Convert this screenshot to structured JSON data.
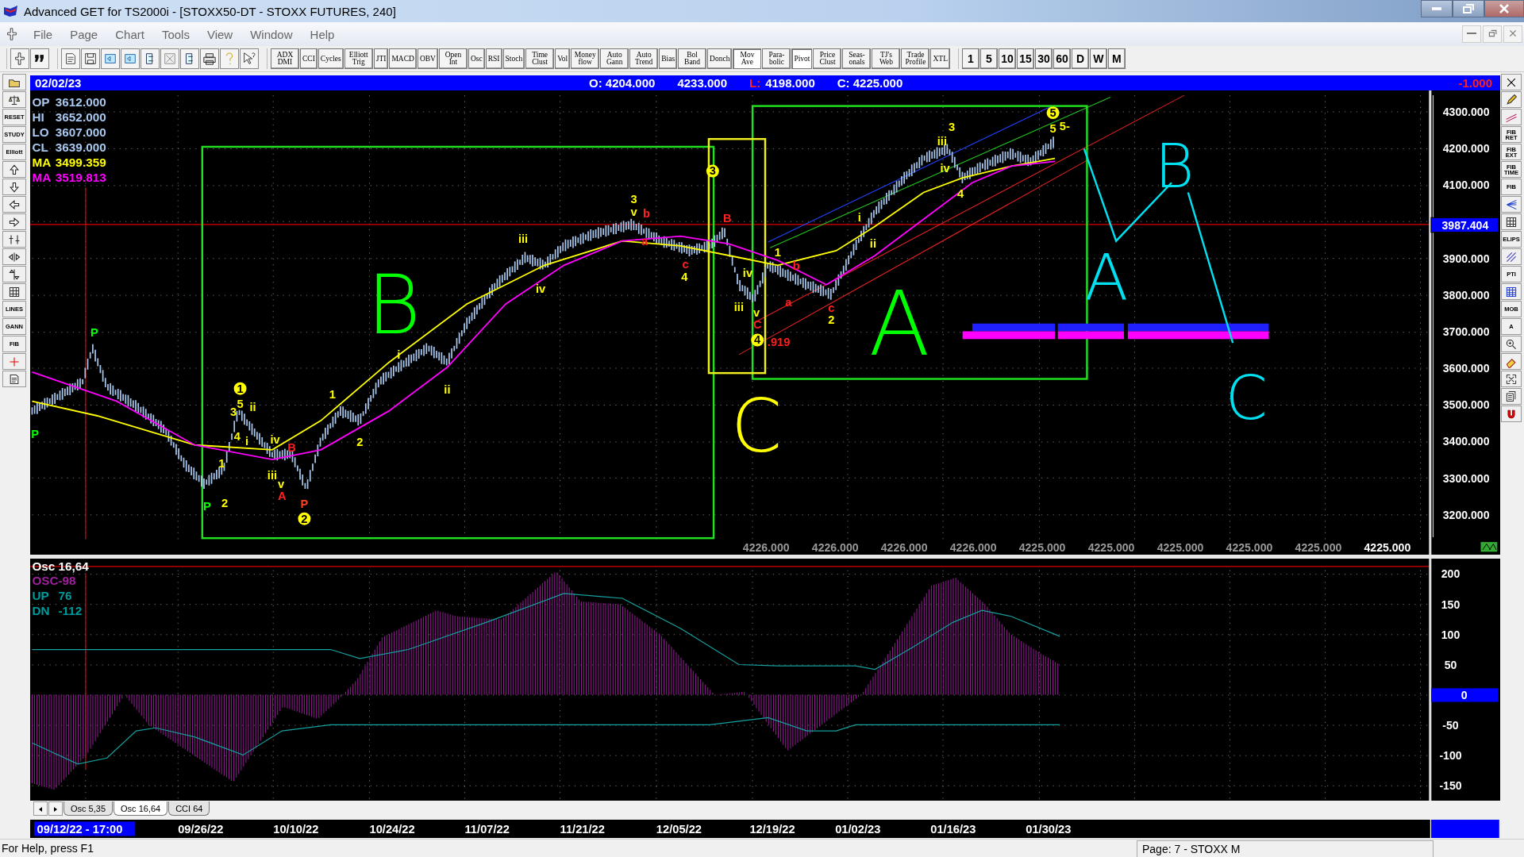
{
  "window": {
    "title": "Advanced GET for TS2000i - [STOXX50-DT - STOXX FUTURES, 240]"
  },
  "menu": [
    "File",
    "Page",
    "Chart",
    "Tools",
    "View",
    "Window",
    "Help"
  ],
  "study_buttons": [
    {
      "label": "ADX DMI",
      "selected": false
    },
    {
      "label": "CCI",
      "selected": false
    },
    {
      "label": "Cycles",
      "selected": false
    },
    {
      "label": "Elliott Trig",
      "selected": false
    },
    {
      "label": "JTI",
      "selected": false
    },
    {
      "label": "MACD",
      "selected": false
    },
    {
      "label": "OBV",
      "selected": false
    },
    {
      "label": "Open Int",
      "selected": false
    },
    {
      "label": "Osc",
      "selected": false
    },
    {
      "label": "RSI",
      "selected": false
    },
    {
      "label": "Stoch",
      "selected": false
    },
    {
      "label": "Time Clust",
      "selected": false
    },
    {
      "label": "Vol",
      "selected": false
    },
    {
      "label": "Money flow",
      "selected": false
    },
    {
      "label": "Auto Gann",
      "selected": false
    },
    {
      "label": "Auto Trend",
      "selected": false
    },
    {
      "label": "Bias",
      "selected": false
    },
    {
      "label": "Bol Band",
      "selected": false
    },
    {
      "label": "Donch",
      "selected": false
    },
    {
      "label": "Mov Ave",
      "selected": true
    },
    {
      "label": "Para-bolic",
      "selected": false
    },
    {
      "label": "Pivot",
      "selected": true
    },
    {
      "label": "Price Clust",
      "selected": false
    },
    {
      "label": "Seas-onals",
      "selected": false
    },
    {
      "label": "TJ's Web",
      "selected": false
    },
    {
      "label": "Trade Profile",
      "selected": false
    },
    {
      "label": "XTL",
      "selected": false
    }
  ],
  "period_buttons": [
    {
      "label": "1",
      "selected": false
    },
    {
      "label": "5",
      "selected": false
    },
    {
      "label": "10",
      "selected": false
    },
    {
      "label": "15",
      "selected": false
    },
    {
      "label": "30",
      "selected": false
    },
    {
      "label": "60",
      "selected": false
    },
    {
      "label": "D",
      "selected": false
    },
    {
      "label": "W",
      "selected": false
    },
    {
      "label": "M",
      "selected": false
    }
  ],
  "left_tools": [
    {
      "kind": "icon"
    },
    {
      "kind": "icon"
    },
    {
      "kind": "labeled",
      "label": "RESET"
    },
    {
      "kind": "labeled",
      "label": "STUDY"
    },
    {
      "kind": "labeled",
      "label": "Elliott"
    },
    {
      "kind": "icon"
    },
    {
      "kind": "icon"
    },
    {
      "kind": "icon"
    },
    {
      "kind": "icon"
    },
    {
      "kind": "icon"
    },
    {
      "kind": "icon"
    },
    {
      "kind": "icon"
    },
    {
      "kind": "icon"
    },
    {
      "kind": "labeled",
      "label": "LINES"
    },
    {
      "kind": "labeled",
      "label": "GANN"
    },
    {
      "kind": "labeled",
      "label": "FIB"
    },
    {
      "kind": "icon"
    },
    {
      "kind": "icon"
    }
  ],
  "right_tools": [
    {
      "kind": "icon"
    },
    {
      "kind": "icon"
    },
    {
      "kind": "icon"
    },
    {
      "kind": "labeled",
      "label": "FIB RET"
    },
    {
      "kind": "labeled",
      "label": "FIB EXT"
    },
    {
      "kind": "labeled",
      "label": "FIB TIME"
    },
    {
      "kind": "labeled",
      "label": "FIB"
    },
    {
      "kind": "icon"
    },
    {
      "kind": "icon"
    },
    {
      "kind": "labeled",
      "label": "ELIPS"
    },
    {
      "kind": "icon"
    },
    {
      "kind": "labeled",
      "label": "PTI"
    },
    {
      "kind": "icon"
    },
    {
      "kind": "labeled",
      "label": "MOB"
    },
    {
      "kind": "labeled",
      "label": "A"
    },
    {
      "kind": "icon"
    },
    {
      "kind": "icon"
    },
    {
      "kind": "icon"
    },
    {
      "kind": "icon"
    },
    {
      "kind": "icon"
    }
  ],
  "info_bar": {
    "date": "02/02/23",
    "items": [
      {
        "text": "O: 4204.000",
        "kind": "plain"
      },
      {
        "text": "4233.000",
        "kind": "plain"
      },
      {
        "text": "L:",
        "kind": "alert"
      },
      {
        "text": "4198.000",
        "kind": "plain"
      },
      {
        "text": "C: 4225.000",
        "kind": "plain"
      }
    ],
    "change": "-1.000"
  },
  "legend": [
    {
      "name": "OP",
      "value": "3612.000",
      "color": "#a8c8f0"
    },
    {
      "name": "HI",
      "value": "3652.000",
      "color": "#a8c8f0"
    },
    {
      "name": "LO",
      "value": "3607.000",
      "color": "#a8c8f0"
    },
    {
      "name": "CL",
      "value": "3639.000",
      "color": "#a8c8f0"
    },
    {
      "name": "MA",
      "value": "3499.359",
      "color": "#ffff00"
    },
    {
      "name": "MA",
      "value": "3519.813",
      "color": "#ff00ff"
    }
  ],
  "price_axis": {
    "labels": [
      "4300.000",
      "4200.000",
      "4100.000",
      "3900.000",
      "3800.000",
      "3700.000",
      "3600.000",
      "3500.000",
      "3400.000",
      "3300.000",
      "3200.000"
    ],
    "marker": "3987.404"
  },
  "bottom_values": [
    {
      "text": "4226.000",
      "current": false
    },
    {
      "text": "4226.000",
      "current": false
    },
    {
      "text": "4226.000",
      "current": false
    },
    {
      "text": "4226.000",
      "current": false
    },
    {
      "text": "4225.000",
      "current": false
    },
    {
      "text": "4225.000",
      "current": false
    },
    {
      "text": "4225.000",
      "current": false
    },
    {
      "text": "4225.000",
      "current": false
    },
    {
      "text": "4225.000",
      "current": false
    },
    {
      "text": "4225.000",
      "current": true
    }
  ],
  "wave_labels": [
    {
      "text": "1",
      "color": "#ffff00",
      "kind": "circled"
    },
    {
      "text": "5",
      "color": "#ffff00",
      "kind": "plain"
    },
    {
      "text": "3",
      "color": "#ffff00",
      "kind": "plain"
    },
    {
      "text": "ii",
      "color": "#ffff00",
      "kind": "plain"
    },
    {
      "text": "4",
      "color": "#ffff00",
      "kind": "plain"
    },
    {
      "text": "i",
      "color": "#ffff00",
      "kind": "plain"
    },
    {
      "text": "iv",
      "color": "#ffff00",
      "kind": "plain"
    },
    {
      "text": "B",
      "color": "#ff2020",
      "kind": "plain"
    },
    {
      "text": "iii",
      "color": "#ffff00",
      "kind": "plain"
    },
    {
      "text": "v",
      "color": "#ffff00",
      "kind": "plain"
    },
    {
      "text": "A",
      "color": "#ff2020",
      "kind": "plain"
    },
    {
      "text": "P",
      "color": "#ff4020",
      "kind": "plain"
    },
    {
      "text": "2",
      "color": "#ffff00",
      "kind": "circled"
    },
    {
      "text": "1",
      "color": "#ffff00",
      "kind": "plain"
    },
    {
      "text": "2",
      "color": "#ffff00",
      "kind": "plain"
    },
    {
      "text": "P",
      "color": "#00ff00",
      "kind": "plain"
    },
    {
      "text": "P",
      "color": "#00ff00",
      "kind": "plain"
    },
    {
      "text": "P",
      "color": "#00ff00",
      "kind": "plain"
    },
    {
      "text": "1",
      "color": "#ffff00",
      "kind": "plain"
    },
    {
      "text": "2",
      "color": "#ffff00",
      "kind": "plain"
    },
    {
      "text": "i",
      "color": "#ffff00",
      "kind": "plain"
    },
    {
      "text": "ii",
      "color": "#ffff00",
      "kind": "plain"
    },
    {
      "text": "iii",
      "color": "#ffff00",
      "kind": "plain"
    },
    {
      "text": "iv",
      "color": "#ffff00",
      "kind": "plain"
    },
    {
      "text": "3",
      "color": "#ffff00",
      "kind": "plain"
    },
    {
      "text": "v",
      "color": "#ffff00",
      "kind": "plain"
    },
    {
      "text": "b",
      "color": "#ff2020",
      "kind": "plain"
    },
    {
      "text": "a",
      "color": "#ff2020",
      "kind": "plain"
    },
    {
      "text": "c",
      "color": "#ff2020",
      "kind": "plain"
    },
    {
      "text": "4",
      "color": "#ffff00",
      "kind": "plain"
    },
    {
      "text": "3",
      "color": "#ffff00",
      "kind": "circled"
    },
    {
      "text": "B",
      "color": "#ff2020",
      "kind": "plain"
    },
    {
      "text": "iv",
      "color": "#ffff00",
      "kind": "plain"
    },
    {
      "text": "iii",
      "color": "#ffff00",
      "kind": "plain"
    },
    {
      "text": "v",
      "color": "#ffff00",
      "kind": "plain"
    },
    {
      "text": "C",
      "color": "#ff2020",
      "kind": "plain"
    },
    {
      "text": "1",
      "color": "#ffff00",
      "kind": "plain"
    },
    {
      "text": "b",
      "color": "#ff2020",
      "kind": "plain"
    },
    {
      "text": "a",
      "color": "#ff2020",
      "kind": "plain"
    },
    {
      "text": "c",
      "color": "#ff2020",
      "kind": "plain"
    },
    {
      "text": "2",
      "color": "#ffff00",
      "kind": "plain"
    },
    {
      "text": "4",
      "color": "#ffff00",
      "kind": "circled"
    },
    {
      "text": ".919",
      "color": "#ff2020",
      "kind": "plain"
    },
    {
      "text": "i",
      "color": "#ffff00",
      "kind": "plain"
    },
    {
      "text": "ii",
      "color": "#ffff00",
      "kind": "plain"
    },
    {
      "text": "3",
      "color": "#ffff00",
      "kind": "plain"
    },
    {
      "text": "iii",
      "color": "#ffff00",
      "kind": "plain"
    },
    {
      "text": "iv",
      "color": "#ffff00",
      "kind": "plain"
    },
    {
      "text": "4",
      "color": "#ffff00",
      "kind": "plain"
    },
    {
      "text": "5",
      "color": "#ffff00",
      "kind": "circled"
    },
    {
      "text": "5",
      "color": "#ffff00",
      "kind": "plain"
    },
    {
      "text": "5-",
      "color": "#ffff00",
      "kind": "plain"
    }
  ],
  "annotations": [
    {
      "text": "B",
      "color": "#00ff00"
    },
    {
      "text": "A",
      "color": "#00ff00"
    },
    {
      "text": "C",
      "color": "#ffff00"
    },
    {
      "text": "B",
      "color": "#00e0f0"
    },
    {
      "text": "A",
      "color": "#00e0f0"
    },
    {
      "text": "C",
      "color": "#00e0f0"
    }
  ],
  "osc": {
    "title": "Osc 16,64",
    "legend": [
      {
        "name": "OSC",
        "value": "-98",
        "color": "#a020a0"
      },
      {
        "name": "UP",
        "value": "76",
        "color": "#009a9a"
      },
      {
        "name": "DN",
        "value": "-112",
        "color": "#009a9a"
      }
    ],
    "axis_labels": [
      {
        "text": "200",
        "kind": "tick"
      },
      {
        "text": "150",
        "kind": "tick"
      },
      {
        "text": "100",
        "kind": "tick"
      },
      {
        "text": "50",
        "kind": "tick"
      },
      {
        "text": "0",
        "kind": "marker"
      },
      {
        "text": "-50",
        "kind": "tick"
      },
      {
        "text": "-100",
        "kind": "tick"
      },
      {
        "text": "-150",
        "kind": "tick"
      }
    ]
  },
  "tabs": [
    {
      "label": "Osc 5,35",
      "selected": false
    },
    {
      "label": "Osc 16,64",
      "selected": true
    },
    {
      "label": "CCI 64",
      "selected": false
    }
  ],
  "date_axis": [
    {
      "text": "09/12/22 - 17:00",
      "selected": true
    },
    {
      "text": "09/26/22",
      "selected": false
    },
    {
      "text": "10/10/22",
      "selected": false
    },
    {
      "text": "10/24/22",
      "selected": false
    },
    {
      "text": "11/07/22",
      "selected": false
    },
    {
      "text": "11/21/22",
      "selected": false
    },
    {
      "text": "12/05/22",
      "selected": false
    },
    {
      "text": "12/19/22",
      "selected": false
    },
    {
      "text": "01/02/23",
      "selected": false
    },
    {
      "text": "01/16/23",
      "selected": false
    },
    {
      "text": "01/30/23",
      "selected": false
    }
  ],
  "status_bar": {
    "help": "For Help, press F1",
    "page": "Page: 7 - STOXX M"
  }
}
